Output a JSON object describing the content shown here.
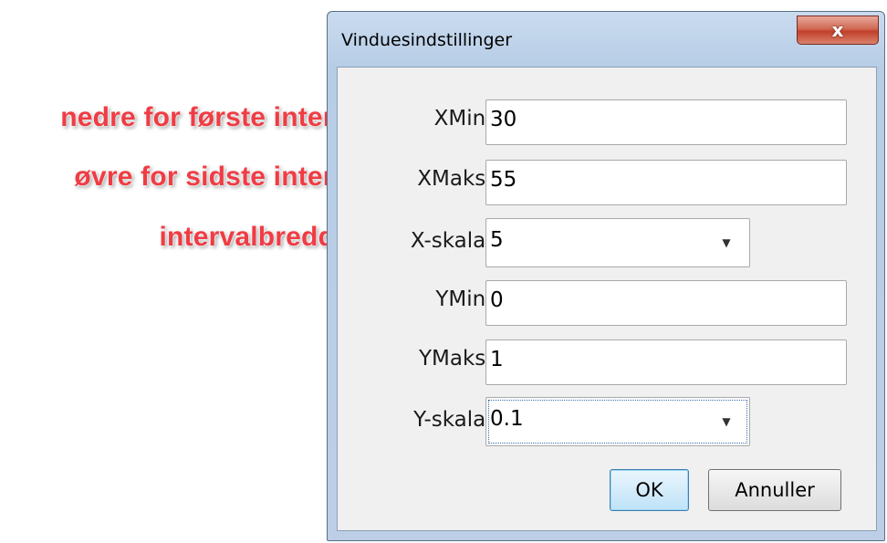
{
  "annotations": {
    "xmin_note": "nedre for første interval",
    "xmax_note": "øvre for sidste interval",
    "xscale_note": "intervalbredde"
  },
  "dialog": {
    "title": "Vinduesindstillinger",
    "close_glyph": "x",
    "fields": {
      "xmin": {
        "label": "XMin:",
        "value": "30"
      },
      "xmax": {
        "label": "XMaks:",
        "value": "55"
      },
      "xscale": {
        "label": "X-skala:",
        "value": "5"
      },
      "ymin": {
        "label": "YMin:",
        "value": "0"
      },
      "ymax": {
        "label": "YMaks:",
        "value": "1"
      },
      "yscale": {
        "label": "Y-skala:",
        "value": "0.1"
      }
    },
    "buttons": {
      "ok": "OK",
      "cancel": "Annuller"
    }
  },
  "colors": {
    "annotation": "#f03c44",
    "close_button": "#c2402a",
    "ok_button_border": "#3c7fb1"
  }
}
